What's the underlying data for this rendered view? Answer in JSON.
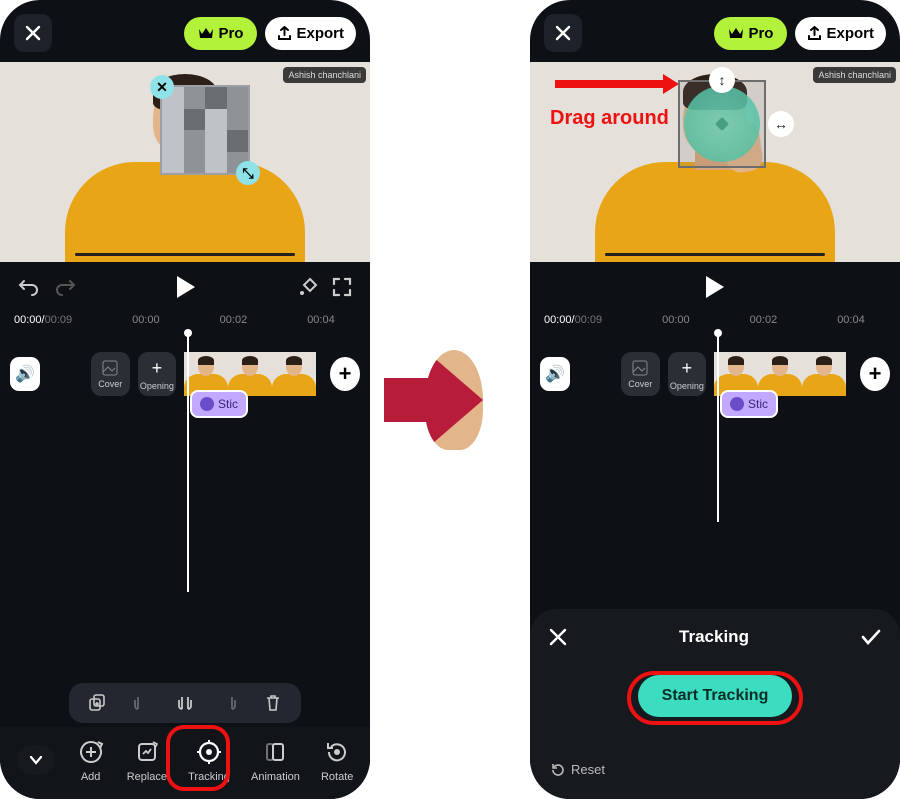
{
  "topbar": {
    "pro_label": "Pro",
    "export_label": "Export"
  },
  "watermark": "Ashish chanchlani",
  "drag_hint": "Drag around",
  "time": {
    "current": "00:00",
    "total": "00:09",
    "marks": [
      "00:00",
      "00:02",
      "00:04"
    ]
  },
  "timeline": {
    "cover_label": "Cover",
    "opening_label": "Opening",
    "add_plus": "+",
    "sticker_chip": "Stic"
  },
  "bottom": {
    "add": "Add",
    "replace": "Replace",
    "tracking": "Tracking",
    "animation": "Animation",
    "rotate": "Rotate"
  },
  "tracking_panel": {
    "title": "Tracking",
    "start": "Start Tracking",
    "reset": "Reset"
  }
}
